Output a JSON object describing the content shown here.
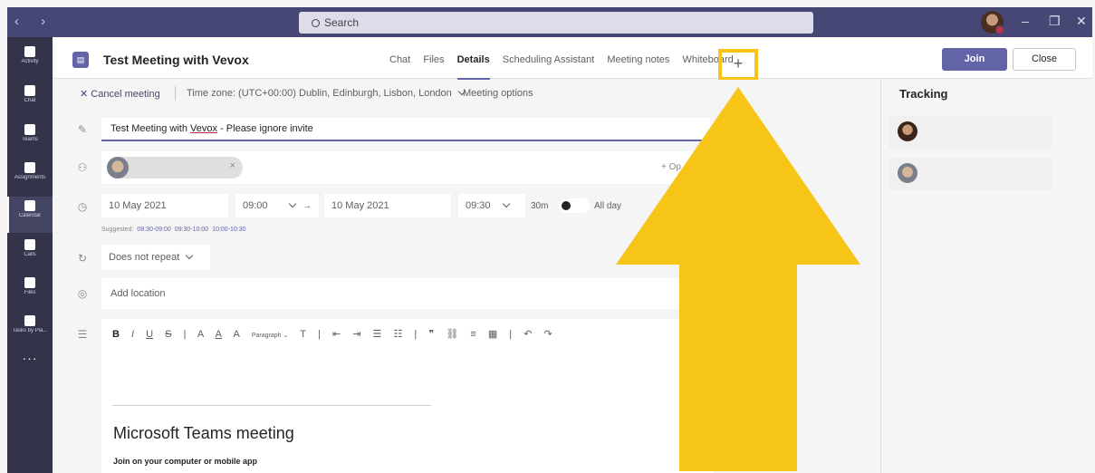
{
  "app": {
    "search_placeholder": "Search",
    "nav_arrows": "‹  ›",
    "window_controls": [
      "–",
      "❐",
      "✕"
    ]
  },
  "rail": {
    "items": [
      {
        "label": "Activity",
        "icon": "bell-icon"
      },
      {
        "label": "Chat",
        "icon": "chat-icon"
      },
      {
        "label": "Teams",
        "icon": "teams-icon"
      },
      {
        "label": "Assignments",
        "icon": "assignments-icon"
      },
      {
        "label": "Calendar",
        "icon": "calendar-icon"
      },
      {
        "label": "Calls",
        "icon": "phone-icon"
      },
      {
        "label": "Files",
        "icon": "file-icon"
      },
      {
        "label": "Tasks by Pla...",
        "icon": "tasks-icon"
      }
    ],
    "more": "···"
  },
  "header": {
    "title": "Test Meeting with Vevox",
    "tabs": [
      "Chat",
      "Files",
      "Details",
      "Scheduling Assistant",
      "Meeting notes",
      "Whiteboard"
    ],
    "active_tab": "Details",
    "add_tab": "+",
    "join_label": "Join",
    "close_label": "Close"
  },
  "subbar": {
    "cancel": "✕ Cancel meeting",
    "timezone": "Time zone: (UTC+00:00) Dublin, Edinburgh, Lisbon, London",
    "options": "Meeting options"
  },
  "form": {
    "title_prefix": "Test Meeting with ",
    "title_brand": "Vevox",
    "title_suffix": " - Please ignore invite",
    "attendee_remove": "×",
    "optional": "+ Op",
    "start_date": "10 May 2021",
    "start_time": "09:00",
    "end_date": "10 May 2021",
    "end_time": "09:30",
    "duration": "30m",
    "all_day": "All day",
    "suggested_label": "Suggested:",
    "suggested_times": [
      "08:30-09:00",
      "09:30-10:00",
      "10:00-10:30"
    ],
    "repeat": "Does not repeat",
    "location_placeholder": "Add location"
  },
  "editor": {
    "toolbar": [
      "B",
      "I",
      "U",
      "S",
      "|",
      "A",
      "A",
      "A",
      "Paragraph ⌄",
      "T",
      "|",
      "⇤",
      "⇥",
      "☰",
      "☷",
      "|",
      "❞",
      "⛓",
      "≡",
      "▦",
      "|",
      "↶",
      "↷"
    ],
    "meeting_heading": "Microsoft Teams meeting",
    "join_text": "Join on your computer or mobile app"
  },
  "tracking": {
    "title": "Tracking"
  },
  "colors": {
    "accent": "#6264a7",
    "highlight": "#f6c518",
    "titlebar": "#464775",
    "rail": "#33344a"
  }
}
